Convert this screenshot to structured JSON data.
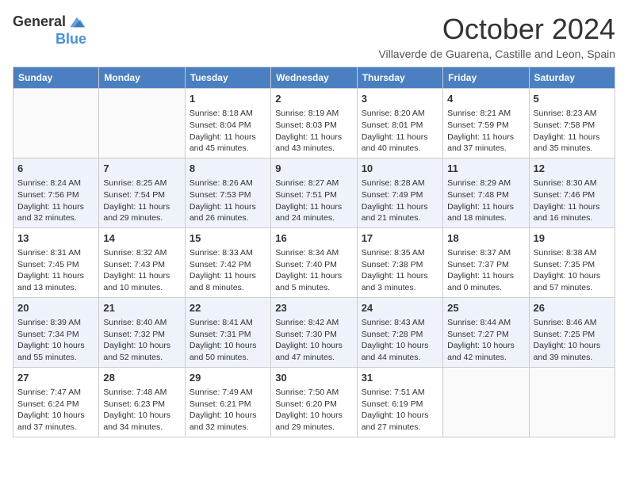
{
  "header": {
    "logo_line1": "General",
    "logo_line2": "Blue",
    "month": "October 2024",
    "location": "Villaverde de Guarena, Castille and Leon, Spain"
  },
  "weekdays": [
    "Sunday",
    "Monday",
    "Tuesday",
    "Wednesday",
    "Thursday",
    "Friday",
    "Saturday"
  ],
  "weeks": [
    [
      {
        "day": "",
        "info": ""
      },
      {
        "day": "",
        "info": ""
      },
      {
        "day": "1",
        "info": "Sunrise: 8:18 AM\nSunset: 8:04 PM\nDaylight: 11 hours and 45 minutes."
      },
      {
        "day": "2",
        "info": "Sunrise: 8:19 AM\nSunset: 8:03 PM\nDaylight: 11 hours and 43 minutes."
      },
      {
        "day": "3",
        "info": "Sunrise: 8:20 AM\nSunset: 8:01 PM\nDaylight: 11 hours and 40 minutes."
      },
      {
        "day": "4",
        "info": "Sunrise: 8:21 AM\nSunset: 7:59 PM\nDaylight: 11 hours and 37 minutes."
      },
      {
        "day": "5",
        "info": "Sunrise: 8:23 AM\nSunset: 7:58 PM\nDaylight: 11 hours and 35 minutes."
      }
    ],
    [
      {
        "day": "6",
        "info": "Sunrise: 8:24 AM\nSunset: 7:56 PM\nDaylight: 11 hours and 32 minutes."
      },
      {
        "day": "7",
        "info": "Sunrise: 8:25 AM\nSunset: 7:54 PM\nDaylight: 11 hours and 29 minutes."
      },
      {
        "day": "8",
        "info": "Sunrise: 8:26 AM\nSunset: 7:53 PM\nDaylight: 11 hours and 26 minutes."
      },
      {
        "day": "9",
        "info": "Sunrise: 8:27 AM\nSunset: 7:51 PM\nDaylight: 11 hours and 24 minutes."
      },
      {
        "day": "10",
        "info": "Sunrise: 8:28 AM\nSunset: 7:49 PM\nDaylight: 11 hours and 21 minutes."
      },
      {
        "day": "11",
        "info": "Sunrise: 8:29 AM\nSunset: 7:48 PM\nDaylight: 11 hours and 18 minutes."
      },
      {
        "day": "12",
        "info": "Sunrise: 8:30 AM\nSunset: 7:46 PM\nDaylight: 11 hours and 16 minutes."
      }
    ],
    [
      {
        "day": "13",
        "info": "Sunrise: 8:31 AM\nSunset: 7:45 PM\nDaylight: 11 hours and 13 minutes."
      },
      {
        "day": "14",
        "info": "Sunrise: 8:32 AM\nSunset: 7:43 PM\nDaylight: 11 hours and 10 minutes."
      },
      {
        "day": "15",
        "info": "Sunrise: 8:33 AM\nSunset: 7:42 PM\nDaylight: 11 hours and 8 minutes."
      },
      {
        "day": "16",
        "info": "Sunrise: 8:34 AM\nSunset: 7:40 PM\nDaylight: 11 hours and 5 minutes."
      },
      {
        "day": "17",
        "info": "Sunrise: 8:35 AM\nSunset: 7:38 PM\nDaylight: 11 hours and 3 minutes."
      },
      {
        "day": "18",
        "info": "Sunrise: 8:37 AM\nSunset: 7:37 PM\nDaylight: 11 hours and 0 minutes."
      },
      {
        "day": "19",
        "info": "Sunrise: 8:38 AM\nSunset: 7:35 PM\nDaylight: 10 hours and 57 minutes."
      }
    ],
    [
      {
        "day": "20",
        "info": "Sunrise: 8:39 AM\nSunset: 7:34 PM\nDaylight: 10 hours and 55 minutes."
      },
      {
        "day": "21",
        "info": "Sunrise: 8:40 AM\nSunset: 7:32 PM\nDaylight: 10 hours and 52 minutes."
      },
      {
        "day": "22",
        "info": "Sunrise: 8:41 AM\nSunset: 7:31 PM\nDaylight: 10 hours and 50 minutes."
      },
      {
        "day": "23",
        "info": "Sunrise: 8:42 AM\nSunset: 7:30 PM\nDaylight: 10 hours and 47 minutes."
      },
      {
        "day": "24",
        "info": "Sunrise: 8:43 AM\nSunset: 7:28 PM\nDaylight: 10 hours and 44 minutes."
      },
      {
        "day": "25",
        "info": "Sunrise: 8:44 AM\nSunset: 7:27 PM\nDaylight: 10 hours and 42 minutes."
      },
      {
        "day": "26",
        "info": "Sunrise: 8:46 AM\nSunset: 7:25 PM\nDaylight: 10 hours and 39 minutes."
      }
    ],
    [
      {
        "day": "27",
        "info": "Sunrise: 7:47 AM\nSunset: 6:24 PM\nDaylight: 10 hours and 37 minutes."
      },
      {
        "day": "28",
        "info": "Sunrise: 7:48 AM\nSunset: 6:23 PM\nDaylight: 10 hours and 34 minutes."
      },
      {
        "day": "29",
        "info": "Sunrise: 7:49 AM\nSunset: 6:21 PM\nDaylight: 10 hours and 32 minutes."
      },
      {
        "day": "30",
        "info": "Sunrise: 7:50 AM\nSunset: 6:20 PM\nDaylight: 10 hours and 29 minutes."
      },
      {
        "day": "31",
        "info": "Sunrise: 7:51 AM\nSunset: 6:19 PM\nDaylight: 10 hours and 27 minutes."
      },
      {
        "day": "",
        "info": ""
      },
      {
        "day": "",
        "info": ""
      }
    ]
  ]
}
